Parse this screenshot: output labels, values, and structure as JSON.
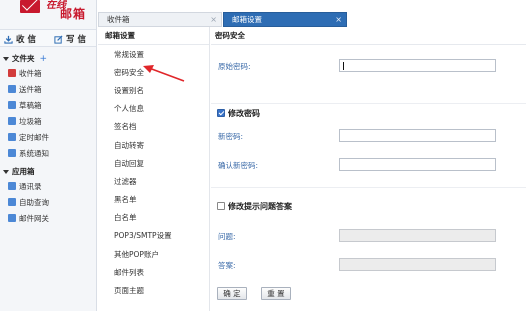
{
  "logo": {
    "script_text": "在线",
    "name": "邮箱"
  },
  "actions": {
    "receive": "收 信",
    "compose": "写 信"
  },
  "folders": {
    "title": "文件夹",
    "add": "+",
    "items": [
      {
        "label": "收件箱",
        "color": "#d23b3b"
      },
      {
        "label": "送件箱",
        "color": "#4c88d6"
      },
      {
        "label": "草稿箱",
        "color": "#4c88d6"
      },
      {
        "label": "垃圾箱",
        "color": "#4c88d6"
      },
      {
        "label": "定时邮件",
        "color": "#4c88d6"
      },
      {
        "label": "系统通知",
        "color": "#4c88d6"
      }
    ]
  },
  "apps": {
    "title": "应用箱",
    "items": [
      {
        "label": "通讯录",
        "color": "#4c88d6"
      },
      {
        "label": "自助查询",
        "color": "#4c88d6"
      },
      {
        "label": "邮件网关",
        "color": "#4c88d6"
      }
    ]
  },
  "tabs": [
    {
      "label": "收件箱",
      "close": "×"
    },
    {
      "label": "邮箱设置",
      "close": "×"
    }
  ],
  "settings": {
    "title": "邮箱设置",
    "items": [
      "常规设置",
      "密码安全",
      "设置别名",
      "个人信息",
      "签名档",
      "自动转寄",
      "自动回复",
      "过滤器",
      "黑名单",
      "白名单",
      "POP3/SMTP设置",
      "其他POP账户",
      "邮件列表",
      "页面主题"
    ]
  },
  "panel": {
    "title": "密码安全",
    "original_password_label": "原始密码:",
    "change_password": {
      "checked": true,
      "label": "修改密码"
    },
    "new_password_label": "新密码:",
    "confirm_password_label": "确认新密码:",
    "change_hint": {
      "checked": false,
      "label": "修改提示问题答案"
    },
    "question_label": "问题:",
    "answer_label": "答案:",
    "confirm_button": "确 定",
    "reset_button": "重 置"
  },
  "colors": {
    "accent": "#2e6db4",
    "brand": "#c8192e",
    "annotation_arrow": "#e0262a"
  }
}
